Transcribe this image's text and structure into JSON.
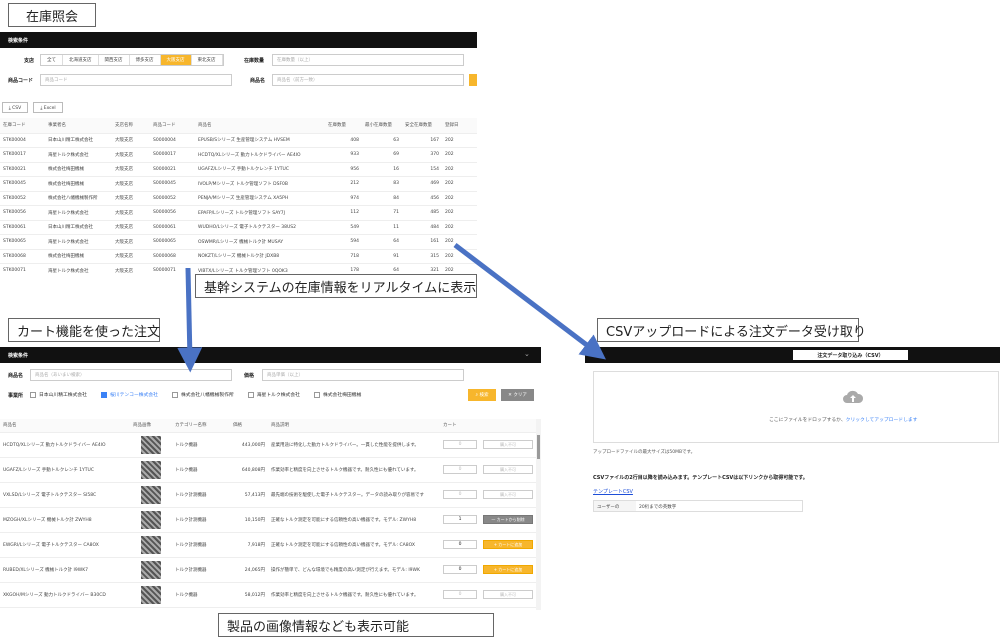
{
  "captions": {
    "inventory": "在庫照会",
    "realtime": "基幹システムの在庫情報をリアルタイムに表示",
    "cart": "カート機能を使った注文",
    "csv": "CSVアップロードによる注文データ受け取り",
    "images": "製品の画像情報なども表示可能"
  },
  "inventory": {
    "search_header": "検索条件",
    "branch_label": "支店",
    "branches": [
      "全て",
      "北海道支店",
      "関西支店",
      "博多支店",
      "大阪支店",
      "東北支店"
    ],
    "branch_selected": 4,
    "stock_label": "在庫数量",
    "stock_placeholder": "在庫数量（以上）",
    "code_label": "商品コード",
    "code_placeholder": "商品コード",
    "name_label": "商品名",
    "name_placeholder": "商品名（前方一致）",
    "csv_btn": "⤓ CSV",
    "excel_btn": "⤓ Excel",
    "columns": [
      "在庫コード",
      "事業者名",
      "支店名称",
      "商品コード",
      "商品名",
      "在庫数量",
      "最小在庫数量",
      "安全在庫数量",
      "登録日"
    ],
    "rows": [
      [
        "STK00004",
        "日本山川精工株式会社",
        "大阪支店",
        "S0000004",
        "EPUSB/Sシリーズ 生産管理システム HVSEM",
        "408",
        "63",
        "167",
        "202"
      ],
      [
        "STK00017",
        "海星トルク株式会社",
        "大阪支店",
        "S0000017",
        "HCDTQ/XLシリーズ 動力トルクドライバー AE4IO",
        "933",
        "69",
        "370",
        "202"
      ],
      [
        "STK00021",
        "株式会社梅田機械",
        "大阪支店",
        "S0000021",
        "UGAFZ/Lシリーズ 手動トルクレンチ 1YTUC",
        "956",
        "16",
        "154",
        "202"
      ],
      [
        "STK00045",
        "株式会社梅田機械",
        "大阪支店",
        "S0000045",
        "IVOLP/Mシリーズ トルク管理ソフト DSF0B",
        "212",
        "83",
        "469",
        "202"
      ],
      [
        "STK00052",
        "株式会社八幡機械製作所",
        "大阪支店",
        "S0000052",
        "PENJA/Mシリーズ 生産管理システム XA5PH",
        "974",
        "84",
        "456",
        "202"
      ],
      [
        "STK00056",
        "海星トルク株式会社",
        "大阪支店",
        "S0000056",
        "EPAFP/Lシリーズ トルク管理ソフト SAY7J",
        "112",
        "71",
        "485",
        "202"
      ],
      [
        "STK00061",
        "日本山川精工株式会社",
        "大阪支店",
        "S0000061",
        "WUDHO/Lシリーズ 電子トルクテスター 38US2",
        "549",
        "11",
        "484",
        "202"
      ],
      [
        "STK00065",
        "海星トルク株式会社",
        "大阪支店",
        "S0000065",
        "OSWMR/Lシリーズ 機械トルク計 MUSAY",
        "594",
        "64",
        "161",
        "202"
      ],
      [
        "STK00068",
        "株式会社梅田機械",
        "大阪支店",
        "S0000068",
        "NOKZT/Lシリーズ 機械トルク計 JDXB8",
        "718",
        "91",
        "315",
        "202"
      ],
      [
        "STK00071",
        "海星トルク株式会社",
        "大阪支店",
        "S0000071",
        "VIBTX/Lシリーズ トルク管理ソフト 0QOK3",
        "178",
        "64",
        "321",
        "202"
      ]
    ]
  },
  "cart": {
    "search_header": "検索条件",
    "name_label": "商品名",
    "name_placeholder": "商品名（あいまい検索）",
    "price_label": "価格",
    "price_placeholder": "商品単価（以上）",
    "vendor_label": "事業所",
    "vendors": [
      {
        "name": "日本山川精工株式会社",
        "checked": false
      },
      {
        "name": "桜川テンコー株式会社",
        "checked": true
      },
      {
        "name": "株式会社八幡機械製作所",
        "checked": false
      },
      {
        "name": "海星トルク株式会社",
        "checked": false
      },
      {
        "name": "株式会社梅田機械",
        "checked": false
      }
    ],
    "search_btn": "⌕ 検索",
    "clear_btn": "✕ クリア",
    "columns": [
      "商品名",
      "商品画像",
      "カテゴリー名称",
      "価格",
      "商品説明",
      "カート",
      ""
    ],
    "rows": [
      {
        "name": "HCDTQ/XLシリーズ 動力トルクドライバー AE4IO",
        "cat": "トルク機器",
        "price": "443,000円",
        "desc": "産業用途に特化した動力トルクドライバー。一貫した性能を提供します。",
        "qty": "0",
        "action": "購入不可",
        "state": "disabled"
      },
      {
        "name": "UGAFZ/Lシリーズ 手動トルクレンチ 1YTUC",
        "cat": "トルク機器",
        "price": "640,808円",
        "desc": "作業効率と精度を向上させるトルク機器です。耐久性にも優れています。",
        "qty": "0",
        "action": "購入不可",
        "state": "disabled"
      },
      {
        "name": "VXLSD/Lシリーズ 電子トルクテスター SI58C",
        "cat": "トルク計測機器",
        "price": "57,413円",
        "desc": "最先端の技術を駆使した電子トルクテスター。データの読み取りが容易です",
        "qty": "0",
        "action": "購入不可",
        "state": "disabled"
      },
      {
        "name": "MZOGH/XLシリーズ 機械トルク計 ZWYH8",
        "cat": "トルク計測機器",
        "price": "10,150円",
        "desc": "正確なトルク測定を可能にする信頼性の高い機器です。モデル: ZWYH8",
        "qty": "1",
        "action": "— カートから削除",
        "state": "del"
      },
      {
        "name": "EWGRI/Lシリーズ 電子トルクテスター CA8OX",
        "cat": "トルク計測機器",
        "price": "7,918円",
        "desc": "正確なトルク測定を可能にする信頼性の高い機器です。モデル: CA8OX",
        "qty": "0",
        "action": "+ カートに追加",
        "state": "add"
      },
      {
        "name": "RUBED/XLシリーズ 機械トルク計 I9WK7",
        "cat": "トルク計測機器",
        "price": "24,065円",
        "desc": "操作が簡単で、どんな環境でも精度の高い測定が行えます。モデル: I9WK",
        "qty": "0",
        "action": "+ カートに追加",
        "state": "add"
      },
      {
        "name": "XKGOH/Mシリーズ 動力トルクドライバー B30CD",
        "cat": "トルク機器",
        "price": "58,012円",
        "desc": "作業効率と精度を向上させるトルク機器です。耐久性にも優れています。",
        "qty": "0",
        "action": "購入不可",
        "state": "disabled"
      }
    ]
  },
  "csv": {
    "title": "注文データ取り込み（CSV）",
    "drop_text": "ここにファイルをドロップするか、",
    "drop_link": "クリックしてアップロードします",
    "max_size": "アップロードファイルの最大サイズは50MBです。",
    "note": "CSVファイルの2行目以降を読み込みます。テンプレートCSVは以下リンクから取得可能です。",
    "template_link": "テンプレートCSV",
    "table_label": "ユーザーの",
    "table_value": "20桁までの英数字"
  },
  "colors": {
    "accent": "#f7b62c",
    "arrow": "#4a72c4",
    "bar": "#111111"
  }
}
